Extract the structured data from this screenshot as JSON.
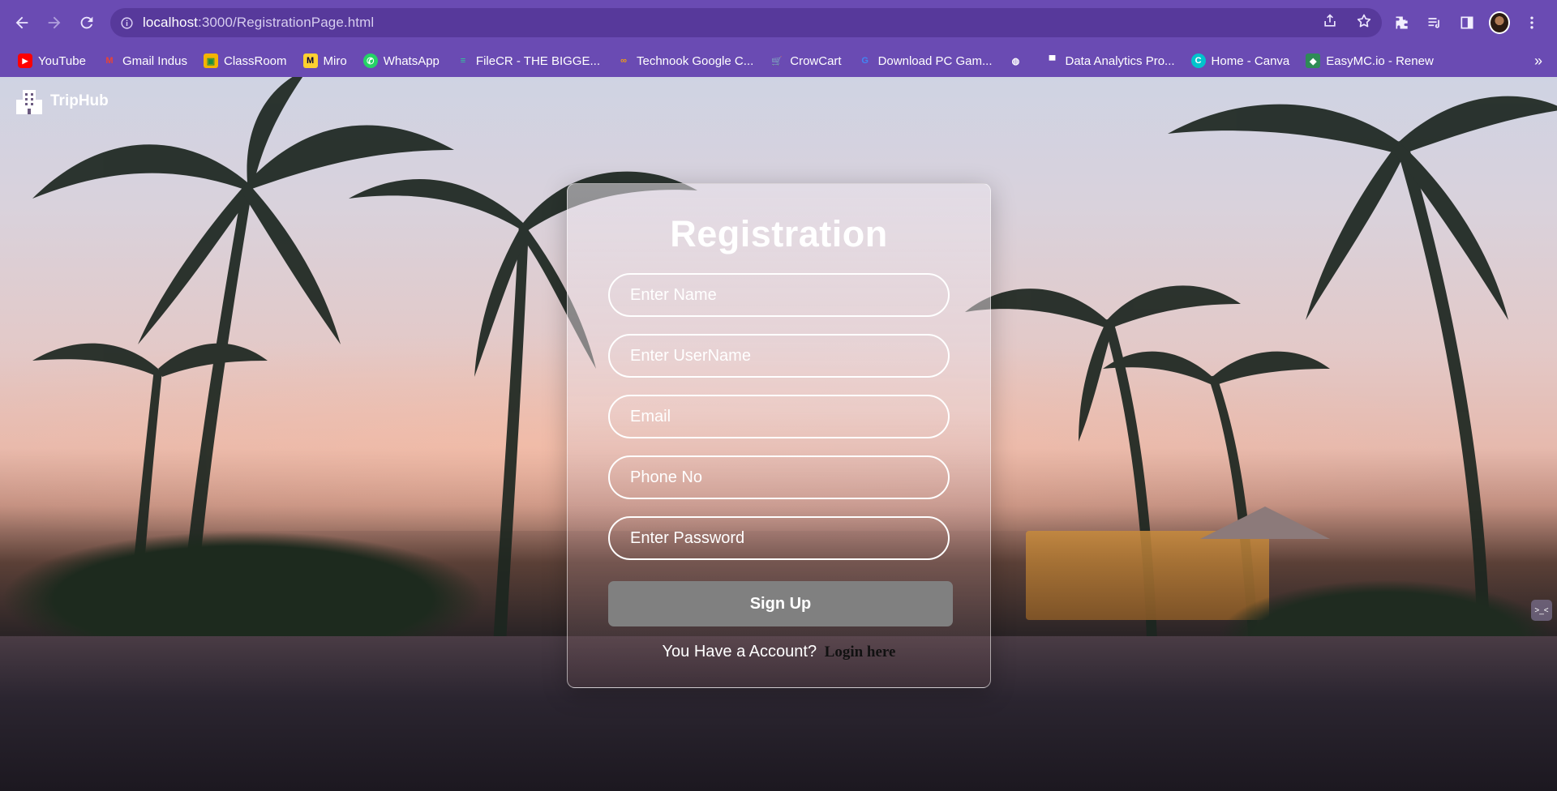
{
  "browser": {
    "url_host": "localhost",
    "url_rest": ":3000/RegistrationPage.html",
    "bookmarks": [
      {
        "label": "YouTube",
        "icon": "youtube-icon",
        "color": "#ff0000"
      },
      {
        "label": "Gmail Indus",
        "icon": "gmail-icon",
        "color": "#ea4335"
      },
      {
        "label": "ClassRoom",
        "icon": "classroom-icon",
        "color": "#f4b400"
      },
      {
        "label": "Miro",
        "icon": "miro-icon",
        "color": "#ffd02f"
      },
      {
        "label": "WhatsApp",
        "icon": "whatsapp-icon",
        "color": "#25d366"
      },
      {
        "label": "FileCR - THE BIGGE...",
        "icon": "filecr-icon",
        "color": "#2ecc9a"
      },
      {
        "label": "Technook Google C...",
        "icon": "technook-icon",
        "color": "#f39c12"
      },
      {
        "label": "CrowCart",
        "icon": "cart-icon",
        "color": "#ffffff"
      },
      {
        "label": "Download PC Gam...",
        "icon": "google-icon",
        "color": "#4285f4"
      },
      {
        "label": "",
        "icon": "globe-icon",
        "color": "#ffffff"
      },
      {
        "label": "Data Analytics Pro...",
        "icon": "data-analytics-icon",
        "color": "#222222"
      },
      {
        "label": "Home - Canva",
        "icon": "canva-icon",
        "color": "#00c4cc"
      },
      {
        "label": "EasyMC.io - Renew",
        "icon": "easymc-icon",
        "color": "#2e8b57"
      }
    ],
    "more_label": "»"
  },
  "page": {
    "brand": "TripHub",
    "form": {
      "title": "Registration",
      "name_placeholder": "Enter Name",
      "username_placeholder": "Enter UserName",
      "email_placeholder": "Email",
      "phone_placeholder": "Phone No",
      "password_placeholder": "Enter Password",
      "submit_label": "Sign Up",
      "footer_text": "You Have a Account?",
      "login_link": "Login here"
    }
  }
}
